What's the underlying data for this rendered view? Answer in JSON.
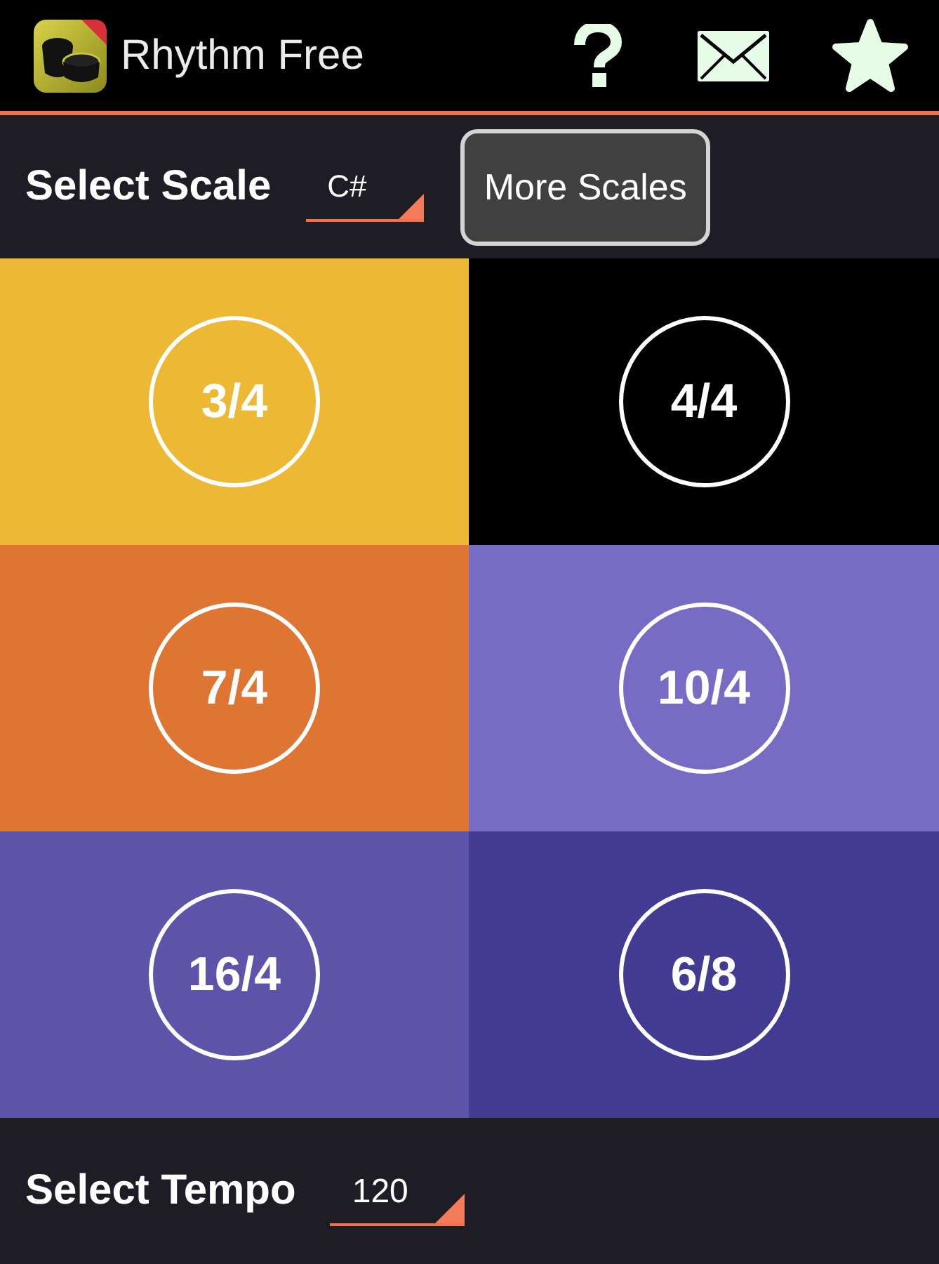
{
  "app_bar": {
    "title": "Rhythm Free"
  },
  "scale": {
    "label": "Select Scale",
    "value": "C#",
    "button": "More Scales"
  },
  "time_signatures": [
    {
      "label": "3/4",
      "color": "#edb833"
    },
    {
      "label": "4/4",
      "color": "#000000"
    },
    {
      "label": "7/4",
      "color": "#de7533"
    },
    {
      "label": "10/4",
      "color": "#786bc4"
    },
    {
      "label": "16/4",
      "color": "#5d53a8"
    },
    {
      "label": "6/8",
      "color": "#413b91"
    }
  ],
  "tempo": {
    "label": "Select Tempo",
    "value": "120"
  }
}
